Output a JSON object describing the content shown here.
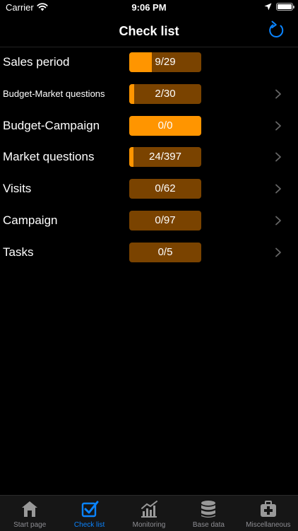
{
  "status": {
    "carrier": "Carrier",
    "time": "9:06 PM"
  },
  "header": {
    "title": "Check list",
    "refresh_icon": "refresh-icon"
  },
  "colors": {
    "accent": "#ff9500",
    "track": "#7a4300",
    "tint": "#0a84ff"
  },
  "rows": [
    {
      "label": "Sales period",
      "progress": "9/29",
      "fraction": 0.31,
      "chevron": false,
      "small": false
    },
    {
      "label": "Budget-Market questions",
      "progress": "2/30",
      "fraction": 0.067,
      "chevron": true,
      "small": true
    },
    {
      "label": "Budget-Campaign",
      "progress": "0/0",
      "fraction": 1.0,
      "chevron": true,
      "small": false
    },
    {
      "label": "Market questions",
      "progress": "24/397",
      "fraction": 0.06,
      "chevron": true,
      "small": false
    },
    {
      "label": "Visits",
      "progress": "0/62",
      "fraction": 0,
      "chevron": true,
      "small": false
    },
    {
      "label": "Campaign",
      "progress": "0/97",
      "fraction": 0,
      "chevron": true,
      "small": false
    },
    {
      "label": "Tasks",
      "progress": "0/5",
      "fraction": 0,
      "chevron": true,
      "small": false
    }
  ],
  "tabs": [
    {
      "label": "Start page",
      "icon": "house-icon",
      "active": false
    },
    {
      "label": "Check list",
      "icon": "checkbox-icon",
      "active": true
    },
    {
      "label": "Monitoring",
      "icon": "chart-icon",
      "active": false
    },
    {
      "label": "Base data",
      "icon": "database-icon",
      "active": false
    },
    {
      "label": "Miscellaneous",
      "icon": "medical-kit-icon",
      "active": false
    }
  ]
}
